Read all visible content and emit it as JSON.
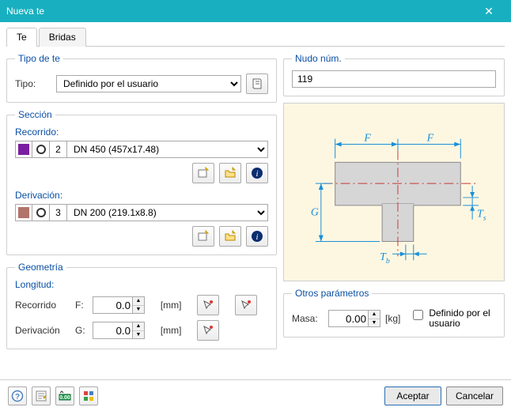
{
  "window": {
    "title": "Nueva te",
    "close": "✕"
  },
  "tabs": {
    "te": "Te",
    "bridas": "Bridas"
  },
  "tipo_de_te": {
    "legend": "Tipo de te",
    "label": "Tipo:",
    "selected": "Definido por el usuario"
  },
  "seccion": {
    "legend": "Sección",
    "recorrido_label": "Recorrido:",
    "recorrido": {
      "color": "#7a1ea1",
      "idx": "2",
      "text": "DN 450 (457x17.48)"
    },
    "derivacion_label": "Derivación:",
    "derivacion": {
      "color": "#b1736a",
      "idx": "3",
      "text": "DN 200 (219.1x8.8)"
    }
  },
  "geometria": {
    "legend": "Geometría",
    "longitud_label": "Longitud:",
    "rows": {
      "recorrido": {
        "name": "Recorrido",
        "sym": "F:",
        "value": "0.0",
        "unit": "[mm]"
      },
      "derivacion": {
        "name": "Derivación",
        "sym": "G:",
        "value": "0.0",
        "unit": "[mm]"
      }
    }
  },
  "nudo": {
    "legend": "Nudo núm.",
    "value": "119"
  },
  "diagram_labels": {
    "F": "F",
    "G": "G",
    "Tb": "T",
    "Tb_sub": "b",
    "Ts": "T",
    "Ts_sub": "s"
  },
  "otros": {
    "legend": "Otros parámetros",
    "masa_label": "Masa:",
    "masa_value": "0.00",
    "masa_unit": "[kg]",
    "def_usuario": "Definido por el usuario"
  },
  "footer": {
    "aceptar": "Aceptar",
    "cancelar": "Cancelar"
  }
}
